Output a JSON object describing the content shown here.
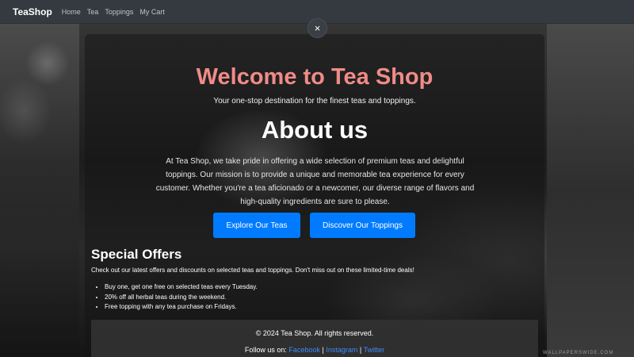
{
  "navbar": {
    "brand": "TeaShop",
    "links": [
      "Home",
      "Tea",
      "Toppings",
      "My Cart"
    ]
  },
  "modal": {
    "close_glyph": "×"
  },
  "hero": {
    "title": "Welcome to Tea Shop",
    "subtitle": "Your one-stop destination for the finest teas and toppings."
  },
  "about": {
    "title": "About us",
    "text": "At Tea Shop, we take pride in offering a wide selection of premium teas and delightful toppings. Our mission is to provide a unique and memorable tea experience for every customer. Whether you're a tea aficionado or a newcomer, our diverse range of flavors and high-quality ingredients are sure to please."
  },
  "buttons": {
    "explore_teas": "Explore Our Teas",
    "discover_toppings": "Discover Our Toppings"
  },
  "offers": {
    "title": "Special Offers",
    "intro": "Check out our latest offers and discounts on selected teas and toppings. Don't miss out on these limited-time deals!",
    "items": [
      "Buy one, get one free on selected teas every Tuesday.",
      "20% off all herbal teas during the weekend.",
      "Free topping with any tea purchase on Fridays."
    ]
  },
  "footer": {
    "copyright": "© 2024 Tea Shop. All rights reserved.",
    "follow_label": "Follow us on:",
    "social": [
      "Facebook",
      "Instagram",
      "Twitter"
    ],
    "separator": "|"
  },
  "watermark": "WALLPAPERSWIDE.COM",
  "colors": {
    "nav_bg": "#343a40",
    "hero_title": "#f08b88",
    "button": "#007bff",
    "link": "#3b8cff",
    "footer_bg": "#2f2f2f"
  }
}
